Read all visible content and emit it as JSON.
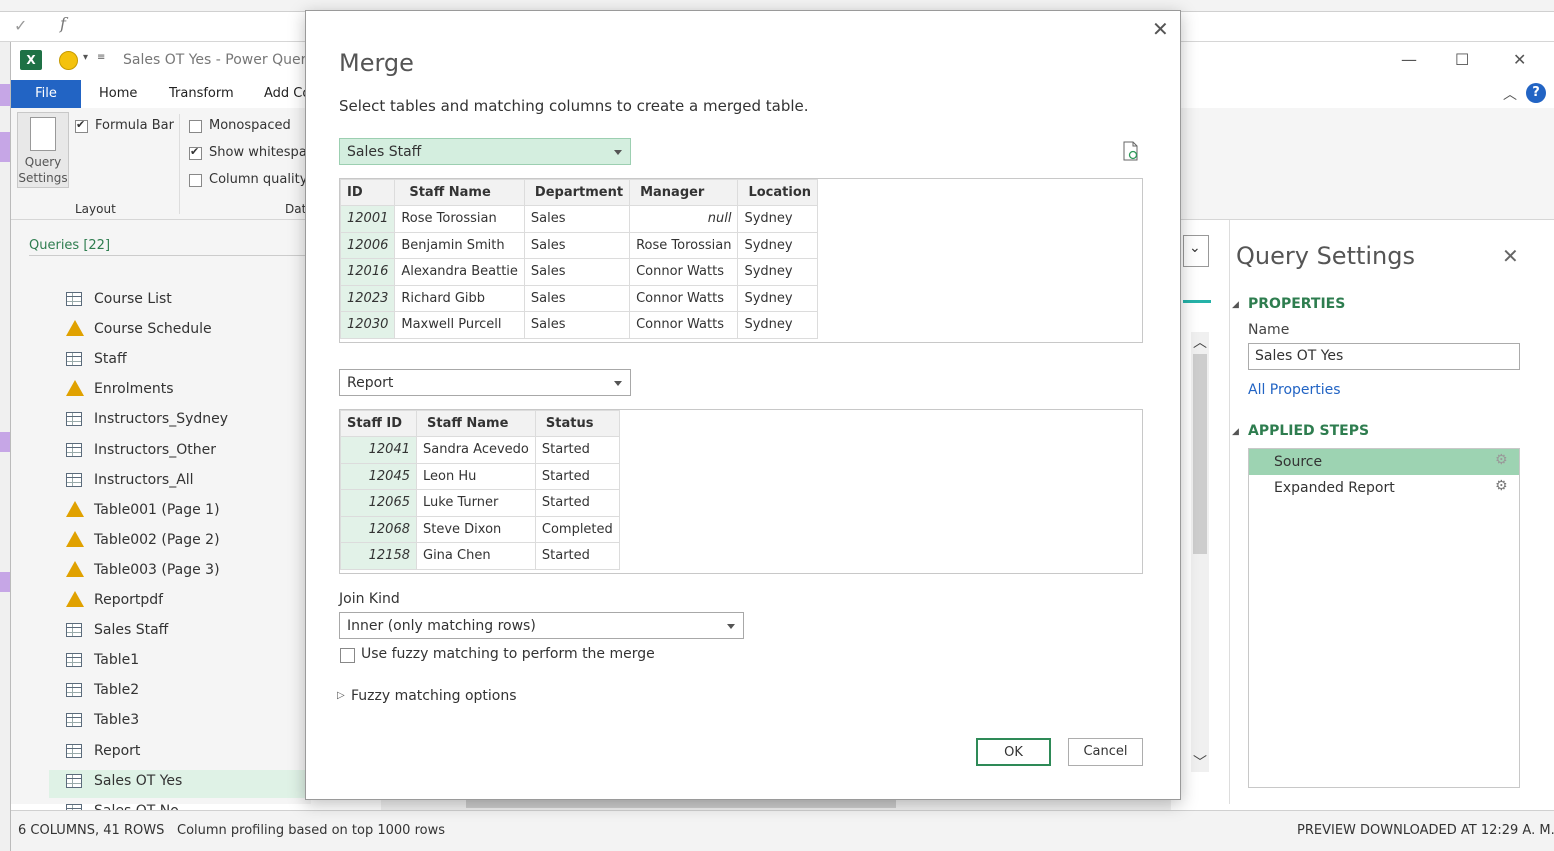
{
  "window": {
    "title": "Sales OT Yes - Power Query"
  },
  "ribbon": {
    "tabs": [
      "File",
      "Home",
      "Transform",
      "Add Co"
    ],
    "query_settings_label_1": "Query",
    "query_settings_label_2": "Settings",
    "formula_bar": "Formula Bar",
    "monospaced": "Monospaced",
    "show_whitespace": "Show whitespace",
    "column_quality": "Column quality",
    "group_layout": "Layout",
    "group_data": "Dat"
  },
  "queries": {
    "header": "Queries [22]",
    "items": [
      {
        "name": "Course List",
        "icon": "table"
      },
      {
        "name": "Course Schedule",
        "icon": "warning"
      },
      {
        "name": "Staff",
        "icon": "table"
      },
      {
        "name": "Enrolments",
        "icon": "warning"
      },
      {
        "name": "Instructors_Sydney",
        "icon": "table"
      },
      {
        "name": "Instructors_Other",
        "icon": "table"
      },
      {
        "name": "Instructors_All",
        "icon": "table"
      },
      {
        "name": "Table001 (Page 1)",
        "icon": "warning"
      },
      {
        "name": "Table002 (Page 2)",
        "icon": "warning"
      },
      {
        "name": "Table003 (Page 3)",
        "icon": "warning"
      },
      {
        "name": "Reportpdf",
        "icon": "warning"
      },
      {
        "name": "Sales Staff",
        "icon": "table"
      },
      {
        "name": "Table1",
        "icon": "table"
      },
      {
        "name": "Table2",
        "icon": "table"
      },
      {
        "name": "Table3",
        "icon": "table"
      },
      {
        "name": "Report",
        "icon": "table"
      },
      {
        "name": "Sales OT Yes",
        "icon": "table",
        "selected": true
      },
      {
        "name": "Sales OT No",
        "icon": "table"
      }
    ]
  },
  "status": {
    "left": "6 COLUMNS, 41 ROWS",
    "middle": "Column profiling based on top 1000 rows",
    "right": "PREVIEW DOWNLOADED AT 12:29 A. M."
  },
  "query_settings": {
    "title": "Query Settings",
    "properties": "PROPERTIES",
    "name_label": "Name",
    "name_value": "Sales OT Yes",
    "all_properties": "All Properties",
    "applied_steps": "APPLIED STEPS",
    "steps": [
      "Source",
      "Expanded Report"
    ]
  },
  "merge": {
    "title": "Merge",
    "subtitle": "Select tables and matching columns to create a merged table.",
    "table1_select": "Sales Staff",
    "table1": {
      "headers": [
        "ID",
        "Staff Name",
        "Department",
        "Manager",
        "Location"
      ],
      "rows": [
        [
          "12001",
          "Rose Torossian",
          "Sales",
          "null",
          "Sydney"
        ],
        [
          "12006",
          "Benjamin Smith",
          "Sales",
          "Rose Torossian",
          "Sydney"
        ],
        [
          "12016",
          "Alexandra Beattie",
          "Sales",
          "Connor Watts",
          "Sydney"
        ],
        [
          "12023",
          "Richard Gibb",
          "Sales",
          "Connor Watts",
          "Sydney"
        ],
        [
          "12030",
          "Maxwell Purcell",
          "Sales",
          "Connor Watts",
          "Sydney"
        ]
      ]
    },
    "table2_select": "Report",
    "table2": {
      "headers": [
        "Staff ID",
        "Staff Name",
        "Status"
      ],
      "rows": [
        [
          "12041",
          "Sandra Acevedo",
          "Started"
        ],
        [
          "12045",
          "Leon Hu",
          "Started"
        ],
        [
          "12065",
          "Luke Turner",
          "Started"
        ],
        [
          "12068",
          "Steve Dixon",
          "Completed"
        ],
        [
          "12158",
          "Gina Chen",
          "Started"
        ]
      ]
    },
    "join_kind_label": "Join Kind",
    "join_kind_value": "Inner (only matching rows)",
    "fuzzy_label": "Use fuzzy matching to perform the merge",
    "fuzzy_options": "Fuzzy matching options",
    "ok": "OK",
    "cancel": "Cancel"
  }
}
